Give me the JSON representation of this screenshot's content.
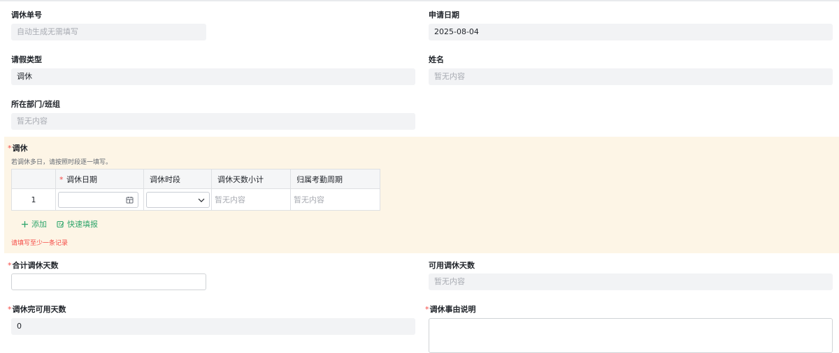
{
  "fields": {
    "order_no": {
      "label": "调休单号",
      "placeholder": "自动生成无需填写"
    },
    "apply_date": {
      "label": "申请日期",
      "value": "2025-08-04"
    },
    "leave_type": {
      "label": "请假类型",
      "value": "调休"
    },
    "name": {
      "label": "姓名",
      "placeholder": "暂无内容"
    },
    "department": {
      "label": "所在部门/班组",
      "placeholder": "暂无内容"
    },
    "total_days": {
      "label": "合计调休天数",
      "required_mark": "*",
      "value": ""
    },
    "available_days": {
      "label": "可用调休天数",
      "placeholder": "暂无内容"
    },
    "remaining_days": {
      "label": "调休完可用天数",
      "required_mark": "*",
      "value": "0"
    },
    "reason": {
      "label": "调休事由说明",
      "required_mark": "*",
      "value": ""
    }
  },
  "section": {
    "title": "调休",
    "required_mark": "*",
    "hint": "若调休多日，请按照时段逐一填写。",
    "columns": [
      {
        "label": "调休日期",
        "required_mark": "*"
      },
      {
        "label": "调休时段"
      },
      {
        "label": "调休天数小计"
      },
      {
        "label": "归属考勤周期"
      }
    ],
    "rows": [
      {
        "index": "1",
        "date": "",
        "period": "",
        "subtotal": "暂无内容",
        "cycle": "暂无内容"
      }
    ],
    "add_label": "添加",
    "quick_fill_label": "快速填报",
    "error": "请填写至少一条记录"
  },
  "icons": {
    "calendar": "calendar-icon",
    "dropdown": "chevron-down-icon",
    "add": "plus-icon",
    "quick_fill": "quick-fill-icon"
  },
  "colors": {
    "accent": "#2ea56b",
    "error": "#f54a45",
    "section_bg": "#fdf5e6",
    "field_bg": "#f2f3f5"
  }
}
